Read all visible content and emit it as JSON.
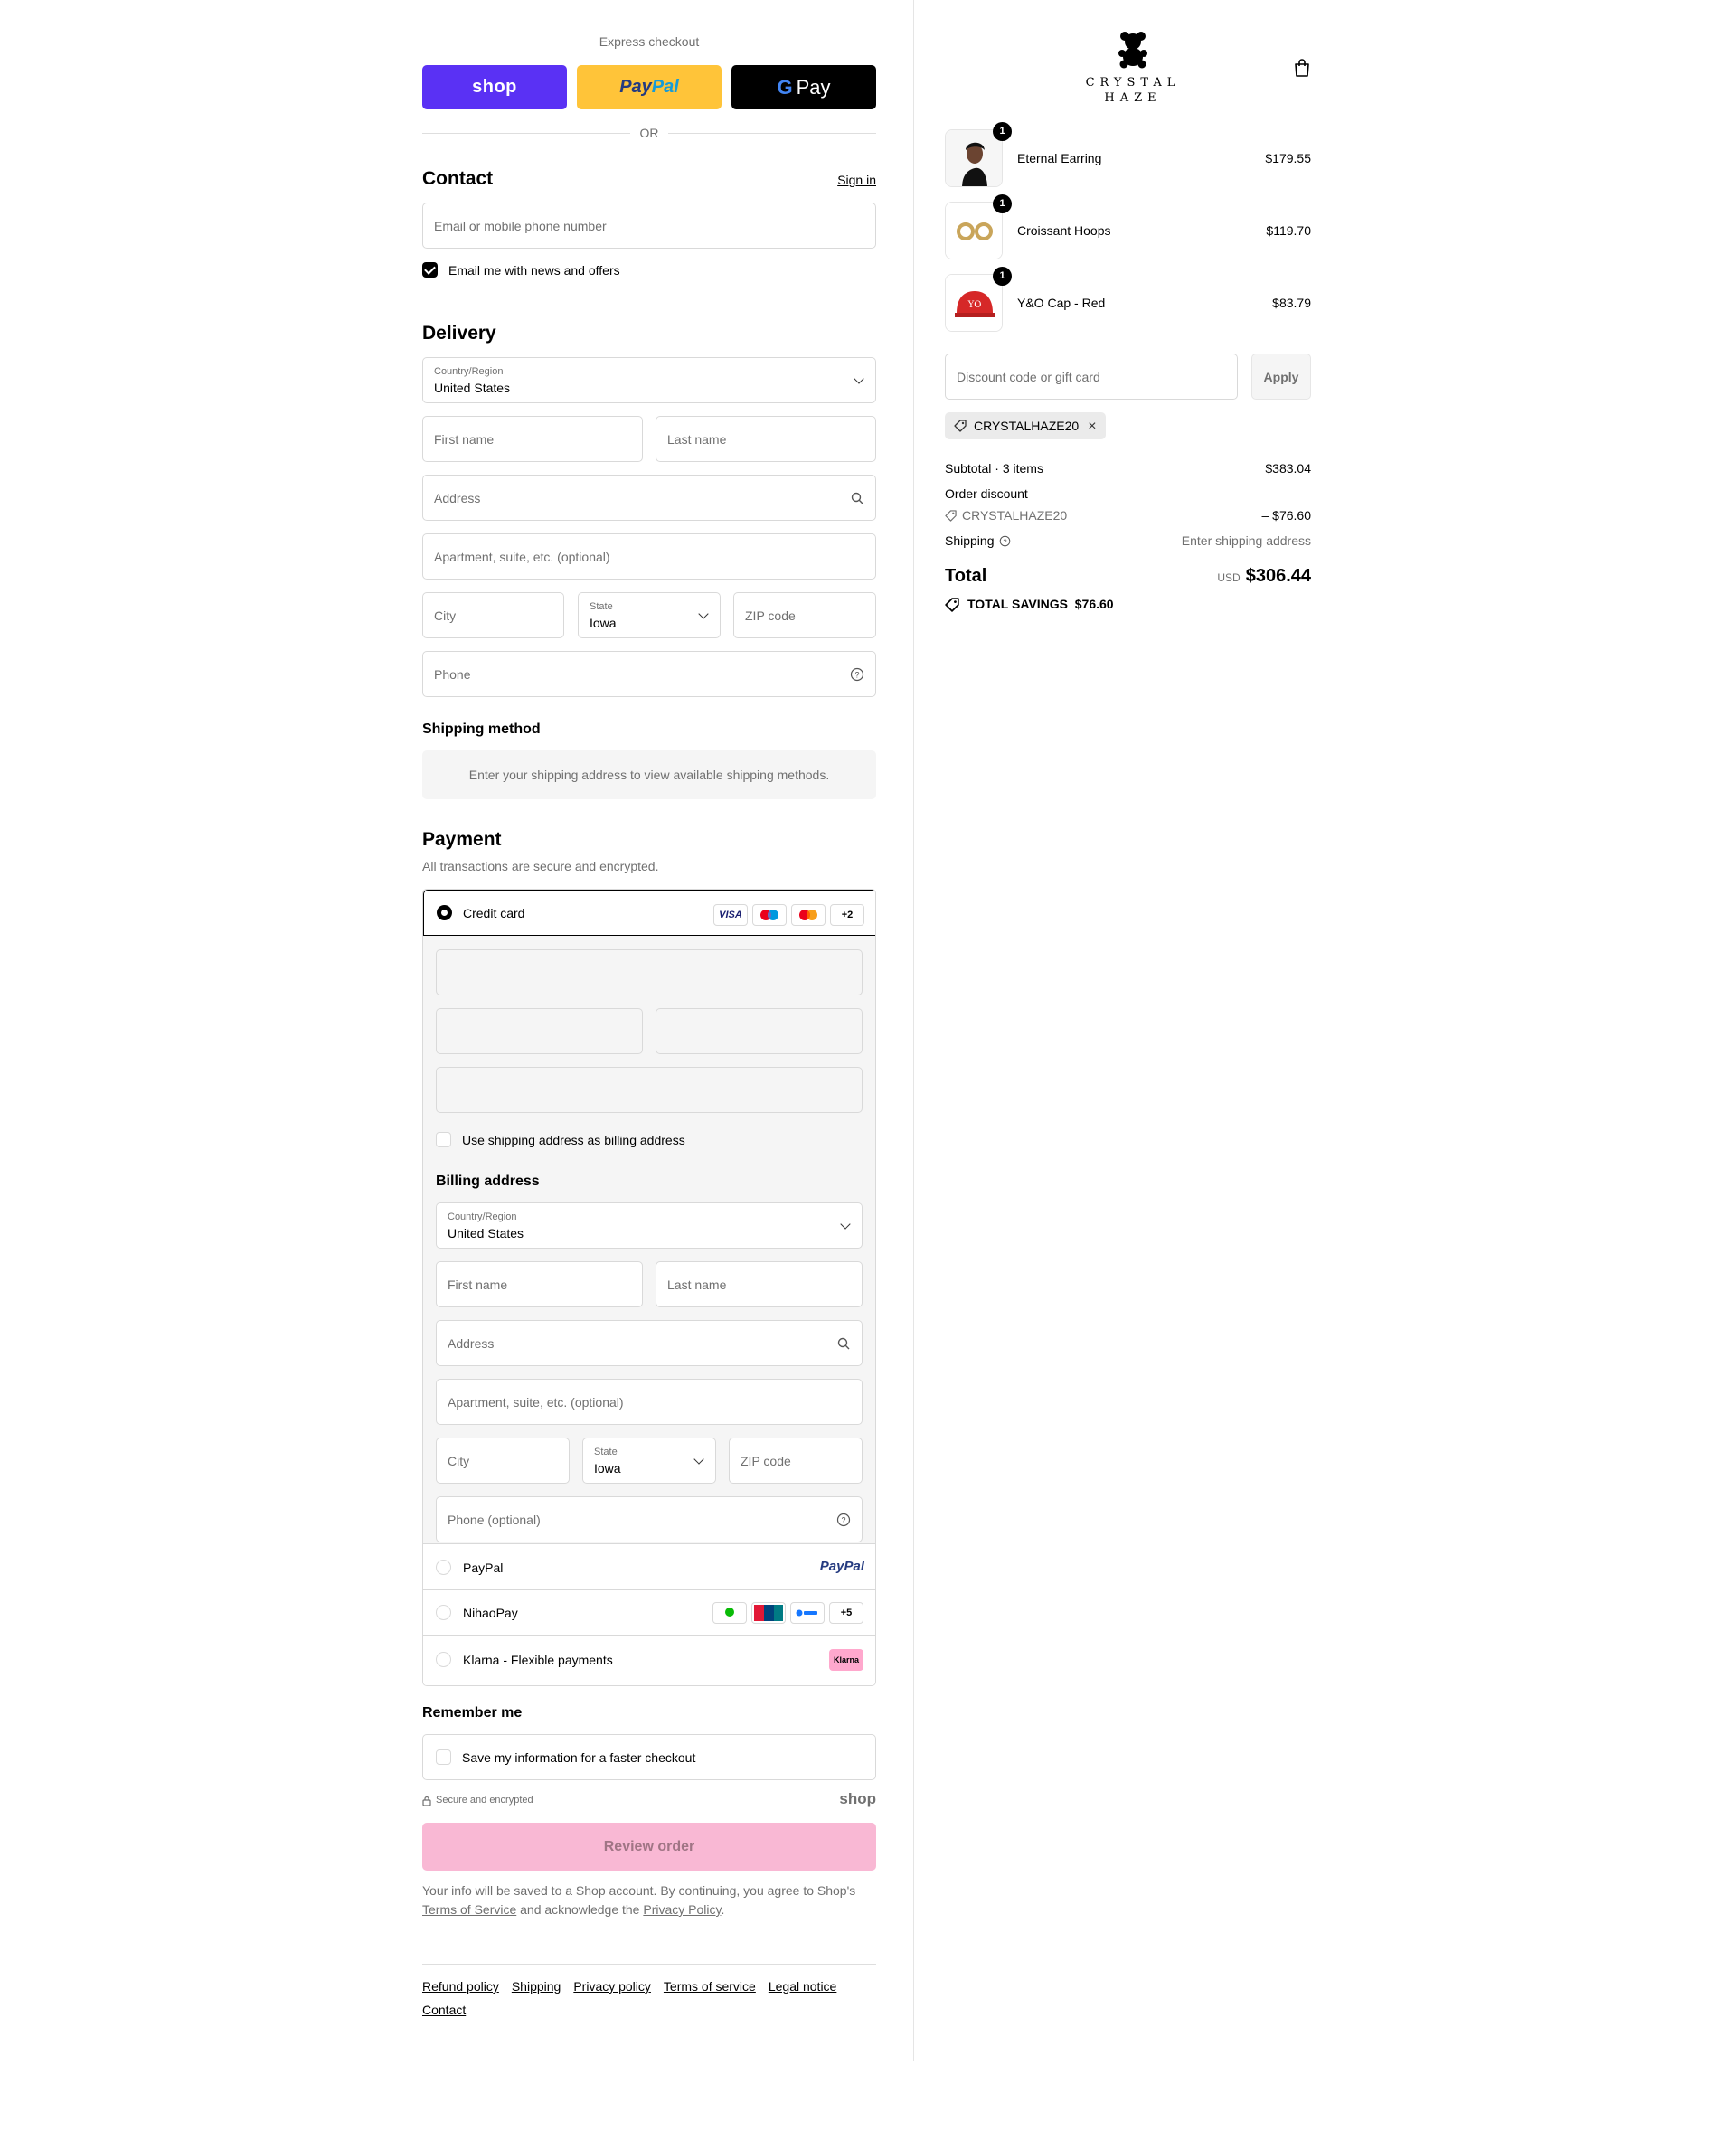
{
  "express": {
    "title": "Express checkout",
    "shop_label": "shop",
    "paypal_label_a": "Pay",
    "paypal_label_b": "Pal",
    "gpay_g": "G",
    "gpay_label": "Pay",
    "or_label": "OR"
  },
  "contact": {
    "heading": "Contact",
    "sign_in": "Sign in",
    "email_placeholder": "Email or mobile phone number",
    "newsletter_label": "Email me with news and offers",
    "newsletter_checked": true
  },
  "delivery": {
    "heading": "Delivery",
    "country_label": "Country/Region",
    "country_value": "United States",
    "first_name": "First name",
    "last_name": "Last name",
    "address": "Address",
    "apartment": "Apartment, suite, etc. (optional)",
    "city": "City",
    "state_label": "State",
    "state_value": "Iowa",
    "zip": "ZIP code",
    "phone": "Phone"
  },
  "shipping_method": {
    "heading": "Shipping method",
    "message": "Enter your shipping address to view available shipping methods."
  },
  "payment": {
    "heading": "Payment",
    "subtitle": "All transactions are secure and encrypted.",
    "credit_card_label": "Credit card",
    "card_badges": [
      "VISA",
      "",
      "",
      "+2"
    ],
    "same_billing_label": "Use shipping address as billing address",
    "billing": {
      "heading": "Billing address",
      "country_label": "Country/Region",
      "country_value": "United States",
      "first_name": "First name",
      "last_name": "Last name",
      "address": "Address",
      "apartment": "Apartment, suite, etc. (optional)",
      "city": "City",
      "state_label": "State",
      "state_value": "Iowa",
      "zip": "ZIP code",
      "phone": "Phone (optional)"
    },
    "options": [
      {
        "name": "PayPal",
        "logo": "PayPal"
      },
      {
        "name": "NihaoPay",
        "extra": "+5"
      },
      {
        "name": "Klarna - Flexible payments",
        "logo": "Klarna"
      }
    ]
  },
  "remember": {
    "heading": "Remember me",
    "label": "Save my information for a faster checkout",
    "secure": "Secure and encrypted",
    "shop_mark": "shop"
  },
  "review_button": "Review order",
  "legal": {
    "line1": "Your info will be saved to a Shop account. By continuing, you agree to Shop's",
    "terms": "Terms of Service",
    "mid": "and acknowledge the",
    "privacy": "Privacy Policy",
    "end": "."
  },
  "footer": {
    "links": [
      "Refund policy",
      "Shipping",
      "Privacy policy",
      "Terms of service",
      "Legal notice",
      "Contact"
    ]
  },
  "brand": {
    "line1": "CRYSTAL",
    "line2": "HAZE"
  },
  "cart": {
    "items": [
      {
        "name": "Eternal Earring",
        "price": "$179.55",
        "qty": "1"
      },
      {
        "name": "Croissant Hoops",
        "price": "$119.70",
        "qty": "1"
      },
      {
        "name": "Y&O Cap - Red",
        "price": "$83.79",
        "qty": "1"
      }
    ],
    "discount_placeholder": "Discount code or gift card",
    "apply_label": "Apply",
    "applied_code": "CRYSTALHAZE20"
  },
  "summary": {
    "subtotal_label": "Subtotal · 3 items",
    "subtotal_value": "$383.04",
    "order_discount_label": "Order discount",
    "discount_code": "CRYSTALHAZE20",
    "discount_value": "– $76.60",
    "shipping_label": "Shipping",
    "shipping_value": "Enter shipping address",
    "total_label": "Total",
    "currency": "USD",
    "total_value": "$306.44",
    "savings_label": "TOTAL SAVINGS",
    "savings_value": "$76.60"
  },
  "colors": {
    "shop_purple": "#5a31f4",
    "paypal_yellow": "#ffc439",
    "review_pink": "#f9b8d4"
  }
}
